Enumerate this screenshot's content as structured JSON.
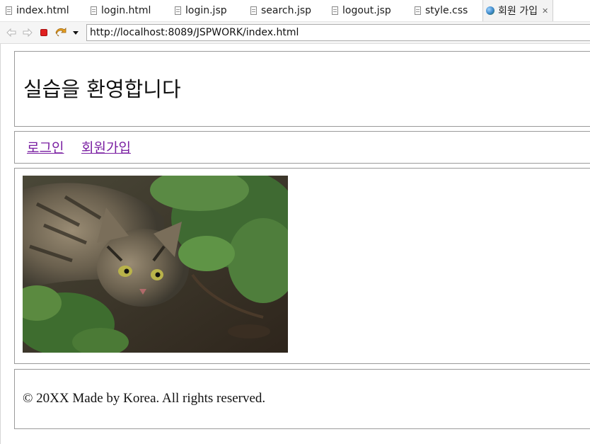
{
  "editor_tabs": [
    {
      "label": "index.html",
      "icon": "file-icon"
    },
    {
      "label": "login.html",
      "icon": "file-icon"
    },
    {
      "label": "login.jsp",
      "icon": "file-icon"
    },
    {
      "label": "search.jsp",
      "icon": "file-icon"
    },
    {
      "label": "logout.jsp",
      "icon": "file-icon"
    },
    {
      "label": "style.css",
      "icon": "file-icon"
    },
    {
      "label": "회원 가입",
      "icon": "globe-icon",
      "active": true
    }
  ],
  "toolbar": {
    "url": "http://localhost:8089/JSPWORK/index.html",
    "icons": [
      "back-icon",
      "forward-icon",
      "stop-icon",
      "refresh-icon",
      "dropdown-icon"
    ]
  },
  "page": {
    "title": "실습을 환영합니다",
    "nav": {
      "login_label": "로그인",
      "signup_label": "회원가입"
    },
    "image": "cat-in-garden-photo",
    "footer": "© 20XX Made by Korea. All rights reserved."
  },
  "colors": {
    "link": "#7a1fa2",
    "border": "#9a9a9a",
    "stop_button": "#e02020"
  }
}
